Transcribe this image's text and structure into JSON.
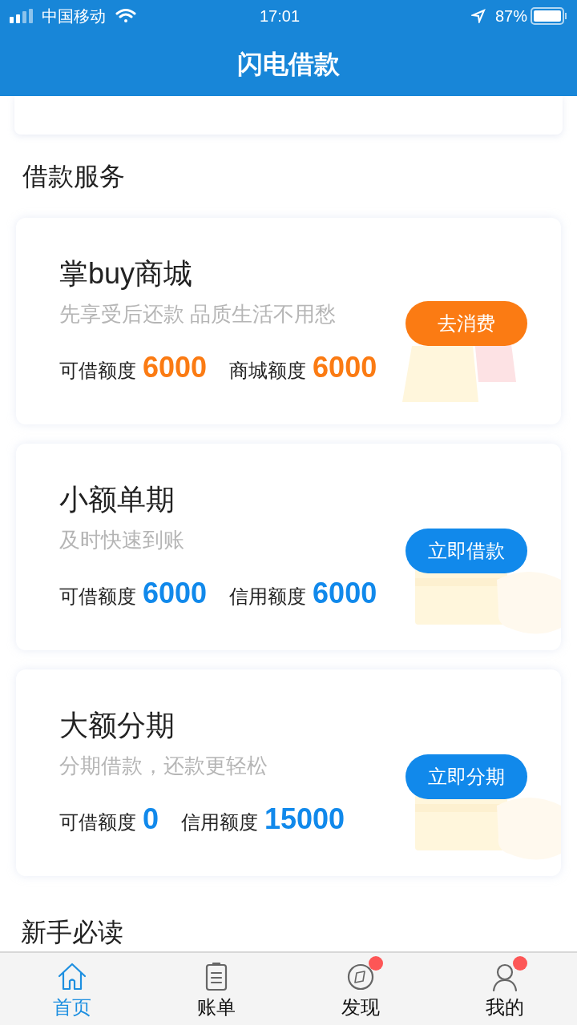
{
  "status_bar": {
    "carrier": "中国移动",
    "time": "17:01",
    "battery": "87%"
  },
  "header": {
    "title": "闪电借款"
  },
  "section_title": "借款服务",
  "cards": [
    {
      "kind": "shop",
      "title": "掌buy商城",
      "subtitle": "先享受后还款 品质生活不用愁",
      "button": "去消费",
      "stats": [
        {
          "label": "可借额度",
          "value": "6000"
        },
        {
          "label": "商城额度",
          "value": "6000"
        }
      ]
    },
    {
      "kind": "loan",
      "title": "小额单期",
      "subtitle": "及时快速到账",
      "button": "立即借款",
      "stats": [
        {
          "label": "可借额度",
          "value": "6000"
        },
        {
          "label": "信用额度",
          "value": "6000"
        }
      ]
    },
    {
      "kind": "loan",
      "title": "大额分期",
      "subtitle": "分期借款，还款更轻松",
      "button": "立即分期",
      "stats": [
        {
          "label": "可借额度",
          "value": "0"
        },
        {
          "label": "信用额度",
          "value": "15000"
        }
      ]
    }
  ],
  "section_title_2": "新手必读",
  "tabs": [
    {
      "label": "首页",
      "selected": true,
      "badge": false
    },
    {
      "label": "账单",
      "selected": false,
      "badge": false
    },
    {
      "label": "发现",
      "selected": false,
      "badge": true
    },
    {
      "label": "我的",
      "selected": false,
      "badge": true
    }
  ]
}
